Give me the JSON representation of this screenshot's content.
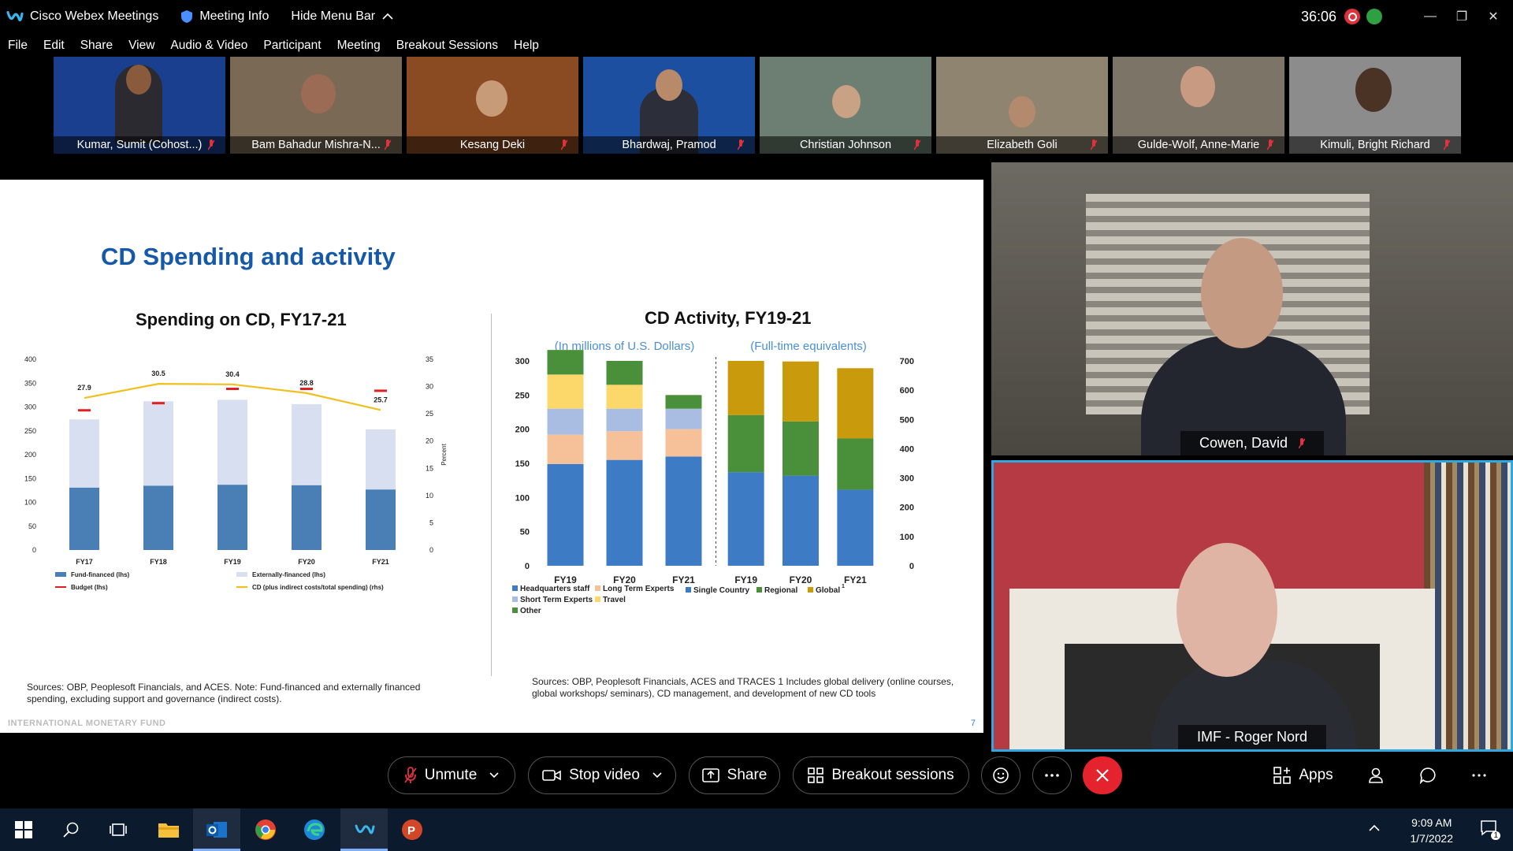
{
  "app": {
    "title": "Cisco Webex Meetings",
    "meeting_info": "Meeting Info",
    "hide_menu": "Hide Menu Bar",
    "timer": "36:06"
  },
  "menu": [
    "File",
    "Edit",
    "Share",
    "View",
    "Audio & Video",
    "Participant",
    "Meeting",
    "Breakout Sessions",
    "Help"
  ],
  "participants": [
    {
      "name": "Kumar, Sumit  (Cohost...)",
      "bg": "#1a3f8f"
    },
    {
      "name": "Bam Bahadur Mishra-N...",
      "bg": "#7a6a55"
    },
    {
      "name": "Kesang Deki",
      "bg": "#8a4a22"
    },
    {
      "name": "Bhardwaj, Pramod",
      "bg": "#1d4fa0"
    },
    {
      "name": "Christian Johnson",
      "bg": "#6d7f72"
    },
    {
      "name": "Elizabeth Goli",
      "bg": "#8f8470"
    },
    {
      "name": "Gulde-Wolf, Anne-Marie",
      "bg": "#7d7468"
    },
    {
      "name": "Kimuli, Bright Richard",
      "bg": "#8c8c8c"
    }
  ],
  "slide": {
    "title": "CD Spending and activity",
    "left_title": "Spending on CD, FY17-21",
    "right_title": "CD Activity, FY19-21",
    "left_source": "Sources: OBP, Peoplesoft Financials, and ACES. Note: Fund-financed and externally financed spending, excluding support and governance (indirect costs).",
    "right_source": "Sources: OBP, Peoplesoft Financials, ACES and TRACES 1 Includes global delivery (online courses, global workshops/ seminars), CD management, and development of new CD tools",
    "footer": "INTERNATIONAL MONETARY FUND",
    "page": "7"
  },
  "chart_data": [
    {
      "type": "bar",
      "title": "Spending on CD, FY17-21",
      "categories": [
        "FY17",
        "FY18",
        "FY19",
        "FY20",
        "FY21"
      ],
      "series": [
        {
          "name": "Fund-financed (lhs)",
          "values": [
            131,
            135,
            137,
            136,
            127
          ],
          "color": "#4a7fb5"
        },
        {
          "name": "Externally-financed (lhs)",
          "values": [
            143,
            177,
            178,
            170,
            126
          ],
          "color": "#d7dff0"
        },
        {
          "name": "Budget (lhs)",
          "values": [
            293,
            308,
            338,
            338,
            334
          ],
          "color": "#e02020"
        },
        {
          "name": "CD (plus indirect costs/total spending) (rhs)",
          "values": [
            27.9,
            30.5,
            30.4,
            28.8,
            25.7
          ],
          "color": "#f0c020"
        }
      ],
      "data_labels": [
        "27.9",
        "30.5",
        "30.4",
        "28.8",
        "25.7"
      ],
      "ylim": [
        0,
        400
      ],
      "y_ticks": [
        "400",
        "350",
        "300",
        "250",
        "200",
        "150",
        "100",
        "50",
        "0"
      ],
      "y2lim": [
        0,
        35
      ],
      "y2_ticks": [
        "35",
        "30",
        "25",
        "20",
        "15",
        "10",
        "5",
        "0"
      ],
      "y2label": "Percent"
    },
    {
      "type": "bar",
      "title": "CD Activity, FY19-21",
      "subtitle_left": "(In millions of U.S. Dollars)",
      "subtitle_right": "(Full-time equivalents)",
      "categories_left": [
        "FY19",
        "FY20",
        "FY21"
      ],
      "series_left": [
        {
          "name": "Headquarters staff",
          "values": [
            149,
            155,
            160
          ],
          "color": "#3d7cc4"
        },
        {
          "name": "Long Term Experts",
          "values": [
            43,
            42,
            40
          ],
          "color": "#f6c199"
        },
        {
          "name": "Short Term Experts",
          "values": [
            38,
            33,
            30
          ],
          "color": "#a9bde3"
        },
        {
          "name": "Travel",
          "values": [
            50,
            35,
            0
          ],
          "color": "#fcd86a"
        },
        {
          "name": "Other",
          "values": [
            36,
            35,
            20
          ],
          "color": "#4a8f3a"
        }
      ],
      "ylim_left": [
        0,
        300
      ],
      "y_ticks_left": [
        "300",
        "250",
        "200",
        "150",
        "100",
        "50",
        "0"
      ],
      "categories_right": [
        "FY19",
        "FY20",
        "FY21"
      ],
      "series_right": [
        {
          "name": "Single Country",
          "values": [
            320,
            308,
            260
          ],
          "color": "#3d7cc4"
        },
        {
          "name": "Regional",
          "values": [
            195,
            185,
            175
          ],
          "color": "#4a8f3a"
        },
        {
          "name": "Global",
          "values": [
            185,
            205,
            240
          ],
          "color": "#c89a0c"
        }
      ],
      "ylim_right": [
        0,
        700
      ],
      "y_ticks_right": [
        "700",
        "600",
        "500",
        "400",
        "300",
        "200",
        "100",
        "0"
      ],
      "footnote": "1"
    }
  ],
  "videos": {
    "top_name": "Cowen, David",
    "bottom_name": "IMF - Roger Nord"
  },
  "controls": {
    "unmute": "Unmute",
    "stop_video": "Stop video",
    "share": "Share",
    "breakout": "Breakout sessions",
    "apps": "Apps"
  },
  "taskbar": {
    "time": "9:09 AM",
    "date": "1/7/2022",
    "notif_count": "1"
  }
}
